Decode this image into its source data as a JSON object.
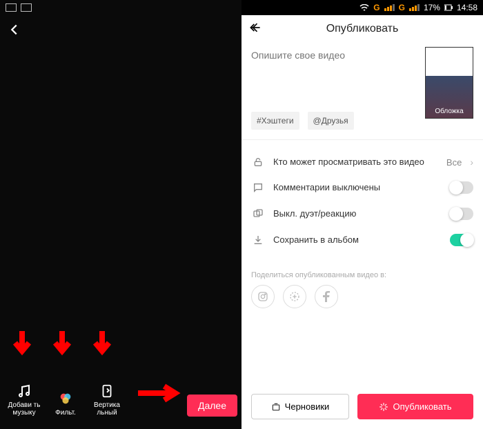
{
  "left": {
    "tools": {
      "music": "Добави\nть\nмузыку",
      "filter": "Фильт.",
      "vertical": "Вертика\nльный"
    },
    "next": "Далее"
  },
  "right": {
    "status": {
      "battery": "17%",
      "time": "14:58",
      "g": "G"
    },
    "title": "Опубликовать",
    "desc_placeholder": "Опишите свое видео",
    "chips": {
      "hashtags": "#Хэштеги",
      "friends": "@Друзья"
    },
    "cover": "Обложка",
    "settings": {
      "privacy_label": "Кто может просматривать это видео",
      "privacy_value": "Все",
      "comments": "Комментарии выключены",
      "duet": "Выкл. дуэт/реакцию",
      "save": "Сохранить в альбом"
    },
    "share_label": "Поделиться опубликованным видео в:",
    "drafts": "Черновики",
    "publish": "Опубликовать"
  }
}
